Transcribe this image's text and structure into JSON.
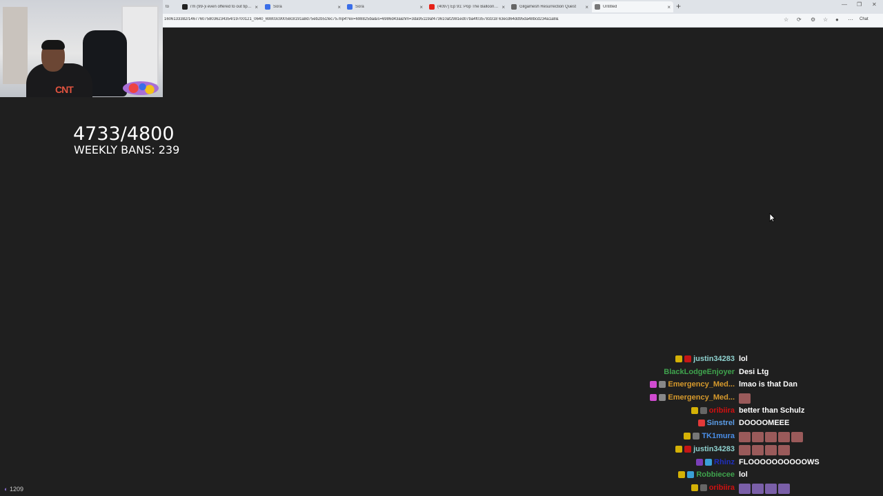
{
  "browser": {
    "tabs": [
      {
        "title": "to",
        "favicon_color": "#c9c9c9"
      },
      {
        "title": "i'm (99-)i even offered to out tip 21 ...",
        "favicon_color": "#222222"
      },
      {
        "title": "Sora",
        "favicon_color": "#3a6ee8"
      },
      {
        "title": "Sora",
        "favicon_color": "#3a6ee8"
      },
      {
        "title": "(4097) Ep 91: Pop The Balloon Or ...",
        "favicon_color": "#e62117"
      },
      {
        "title": "Gilgamesh Resurrection Quest",
        "favicon_color": "#666666"
      },
      {
        "title": "Untitled",
        "favicon_color": "#777777"
      }
    ],
    "close_glyph": "×",
    "new_tab_glyph": "+",
    "url": "1606133382/1467760758036234354/19700121_0640_69803c90058c8191a8d75eb2b51fec75.mp4?ex=698825ba&is=6986d43a&hm=3da95119af473610af2981ed07ba4f035783318 63ecd64dd95da48bcd234a1a8&",
    "chat_button": "Chat"
  },
  "webcam": {
    "shirt_text": "CNT"
  },
  "stats": {
    "counter": "4733/4800",
    "weekly_label": "WEEKLY BANS: 239"
  },
  "chat": {
    "messages": [
      {
        "user": "justin34283",
        "color": "#8fd3d0",
        "text": "lol",
        "badges": [
          "#d4b106",
          "#c31616"
        ]
      },
      {
        "user": "BlackLodgeEnjoyer",
        "color": "#3fa34d",
        "text": "Desi Ltg",
        "badges": []
      },
      {
        "user": "Emergency_Med...",
        "color": "#d79a2c",
        "text": "lmao is that Dan",
        "badges": [
          "#d04bd0",
          "#888888"
        ]
      },
      {
        "user": "Emergency_Med...",
        "color": "#d79a2c",
        "text": "",
        "badges": [
          "#d04bd0",
          "#888888"
        ]
      },
      {
        "user": "oribiira",
        "color": "#d11010",
        "text": "better than Schulz",
        "badges": [
          "#d4b106",
          "#666666"
        ]
      },
      {
        "user": "Sinstrel",
        "color": "#5b9de8",
        "text": "DOOOOMEEE",
        "badges": [
          "#e33939"
        ]
      },
      {
        "user": "TK1mura",
        "color": "#4a8ee8",
        "text": "",
        "emotes": 5,
        "badges": [
          "#d4b106",
          "#777777"
        ]
      },
      {
        "user": "justin34283",
        "color": "#8fd3d0",
        "text": "",
        "emotes": 4,
        "badges": [
          "#d4b106",
          "#c31616"
        ]
      },
      {
        "user": "Rhinz",
        "color": "#1f2fbf",
        "text": "FLOOOOOOOOOOWS",
        "badges": [
          "#7a3fb8",
          "#3aa0d8"
        ]
      },
      {
        "user": "Robbiecee",
        "color": "#3fa34d",
        "text": "lol",
        "badges": [
          "#d4b106",
          "#3aa0d8"
        ]
      },
      {
        "user": "oribiira",
        "color": "#d11010",
        "text": "",
        "emotes": 4,
        "badges": [
          "#d4b106",
          "#666666"
        ]
      }
    ]
  },
  "footer": {
    "viewer_count": "1209"
  }
}
